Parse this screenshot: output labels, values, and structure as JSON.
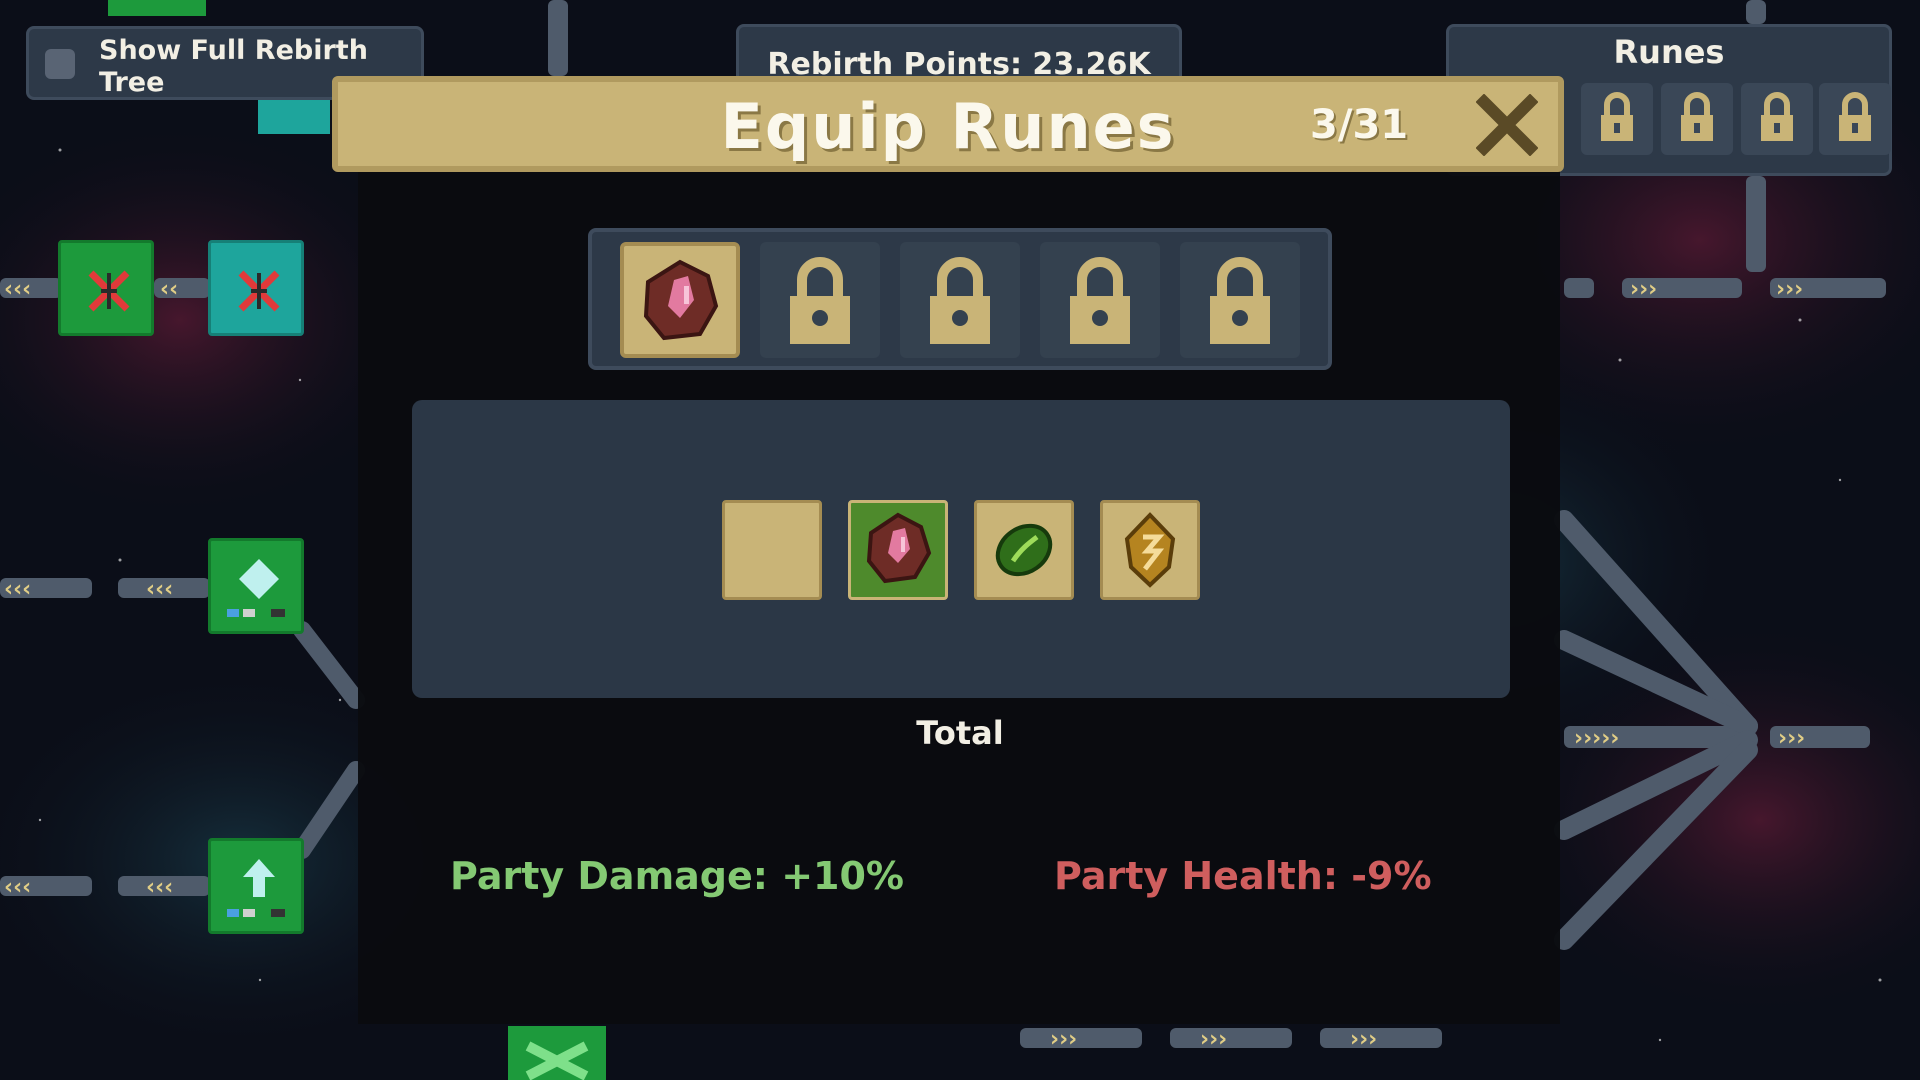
{
  "toggle": {
    "label": "Show Full Rebirth Tree",
    "checked": false
  },
  "rebirth_points": {
    "label": "Rebirth Points: 23.26K"
  },
  "runes_panel": {
    "title": "Runes",
    "visible_slots": 4,
    "slot_state": "locked"
  },
  "modal": {
    "title": "Equip Runes",
    "count": "3/31",
    "close_icon": "close-x-icon",
    "equip_slots": [
      {
        "state": "filled",
        "rune": "pink-crystal-rune-icon"
      },
      {
        "state": "locked",
        "rune": "lock-icon"
      },
      {
        "state": "locked",
        "rune": "lock-icon"
      },
      {
        "state": "locked",
        "rune": "lock-icon"
      },
      {
        "state": "locked",
        "rune": "lock-icon"
      }
    ],
    "inventory": [
      {
        "state": "empty",
        "rune": ""
      },
      {
        "state": "selected",
        "rune": "pink-crystal-rune-icon"
      },
      {
        "state": "owned",
        "rune": "green-leaf-rune-icon"
      },
      {
        "state": "owned",
        "rune": "gold-rune-icon"
      }
    ],
    "total_label": "Total",
    "stats": {
      "damage": "Party Damage: +10%",
      "health": "Party Health: -9%"
    }
  },
  "colors": {
    "gold": "#c9b477",
    "panel": "#2d3948",
    "node_green": "#1d9a3c",
    "node_teal": "#1ea59c",
    "positive": "#84c973",
    "negative": "#cf5e5e"
  }
}
